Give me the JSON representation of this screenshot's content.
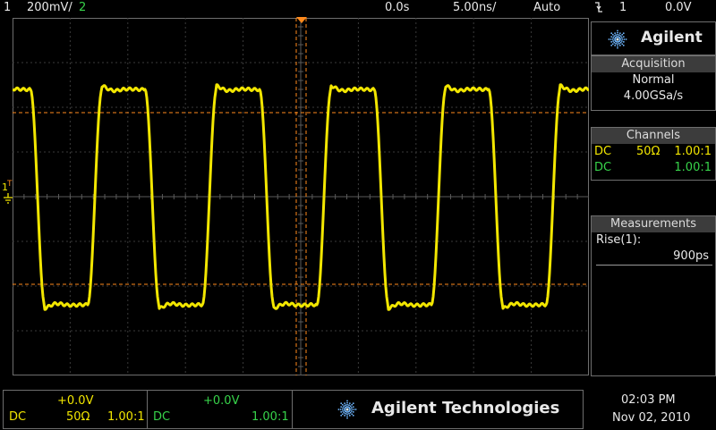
{
  "top_bar": {
    "ch1_number": "1",
    "ch1_scale": "200mV/",
    "ch2_number": "2",
    "time_delay": "0.0s",
    "time_scale": "5.00ns/",
    "trigger_mode": "Auto",
    "trigger_slope_icon": "falling-edge-icon",
    "trigger_source": "1",
    "trigger_level": "0.0V"
  },
  "screen": {
    "ch1_marker": "1",
    "trigger_marker": "T",
    "colors": {
      "ch1": "#f2e600",
      "ch2": "#37d34a",
      "cursor": "#ff8a1c"
    }
  },
  "panel": {
    "brand": "Agilent",
    "acquisition": {
      "title": "Acquisition",
      "mode": "Normal",
      "rate": "4.00GSa/s"
    },
    "channels": {
      "title": "Channels",
      "rows": [
        {
          "coupling": "DC",
          "impedance": "50Ω",
          "probe": "1.00:1"
        },
        {
          "coupling": "DC",
          "impedance": "",
          "probe": "1.00:1"
        }
      ]
    },
    "measurements": {
      "title": "Measurements",
      "label": "Rise(1):",
      "value": "900ps"
    }
  },
  "bottom": {
    "ch1": {
      "offset": "+0.0V",
      "coupling": "DC",
      "impedance": "50Ω",
      "probe": "1.00:1"
    },
    "ch2": {
      "offset": "+0.0V",
      "coupling": "DC",
      "probe": "1.00:1"
    },
    "company": "Agilent Technologies",
    "time": "02:03 PM",
    "date": "Nov 02, 2010"
  }
}
